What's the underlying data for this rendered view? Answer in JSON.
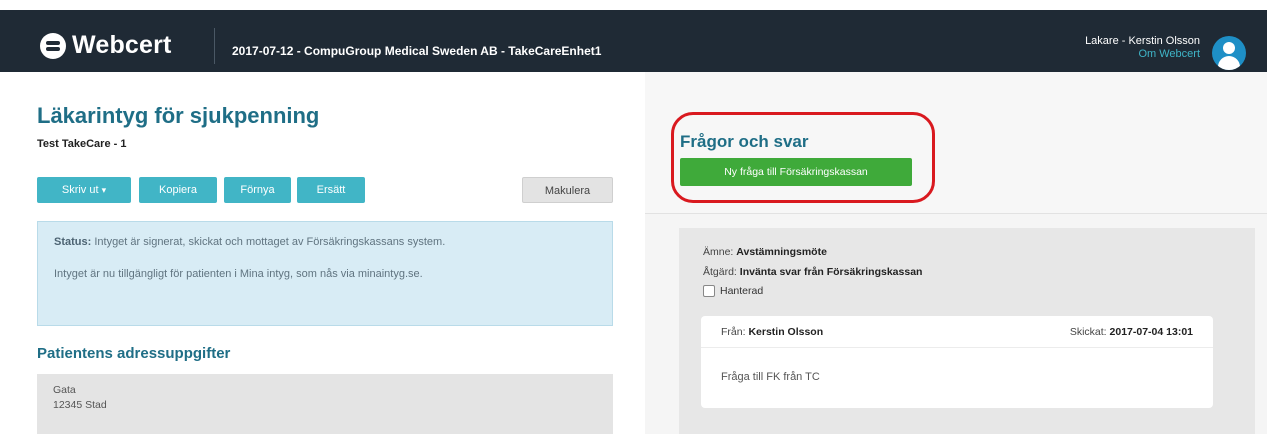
{
  "header": {
    "app_name": "Webcert",
    "context": "2017-07-12 - CompuGroup Medical Sweden AB - TakeCareEnhet1",
    "user_name": "Lakare - Kerstin Olsson",
    "about_link": "Om Webcert"
  },
  "certificate": {
    "title": "Läkarintyg för sjukpenning",
    "patient": "Test TakeCare - 1",
    "buttons": {
      "print": "Skriv ut",
      "copy": "Kopiera",
      "renew": "Förnya",
      "replace": "Ersätt",
      "cancel": "Makulera"
    },
    "status": {
      "label": "Status:",
      "text": " Intyget är signerat, skickat och mottaget av Försäkringskassans system.",
      "availability": "Intyget är nu tillgängligt för patienten i Mina intyg, som nås via minaintyg.se."
    },
    "address": {
      "title": "Patientens adressuppgifter",
      "street": "Gata",
      "city": "12345 Stad"
    }
  },
  "qa": {
    "title": "Frågor och svar",
    "new_question_button": "Ny fråga till Försäkringskassan",
    "question": {
      "subject_label": "Ämne:",
      "subject_value": "Avstämningsmöte",
      "action_label": "Åtgärd:",
      "action_value": "Invänta svar från Försäkringskassan",
      "handled_label": "Hanterad",
      "handled_checked": false,
      "from_label": "Från:",
      "from_value": "Kerstin Olsson",
      "sent_label": "Skickat:",
      "sent_value": "2017-07-04 13:01",
      "body": "Fråga till FK från TC"
    }
  },
  "colors": {
    "header_bg": "#1f2a35",
    "title_teal": "#1f6e86",
    "button_teal": "#41b5c6",
    "button_green": "#3faa3a",
    "highlight_red": "#d9191f",
    "status_bg": "#d8ecf5"
  }
}
